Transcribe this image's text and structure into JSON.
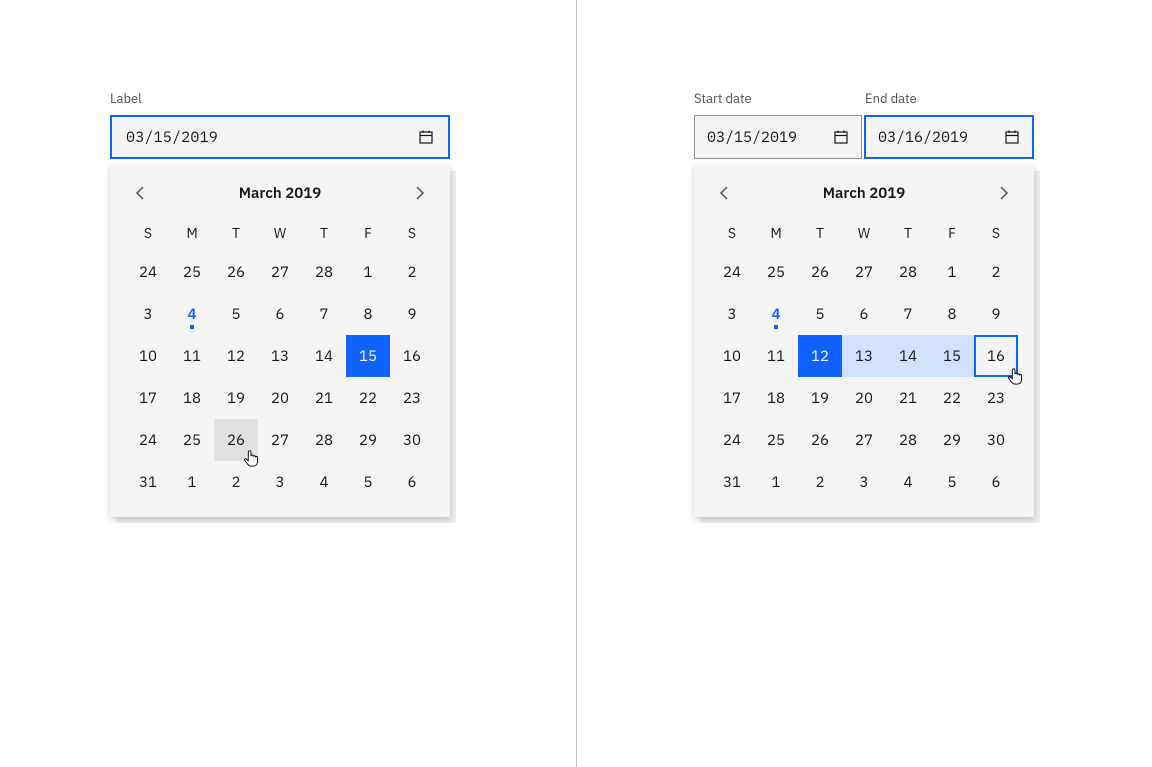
{
  "single": {
    "label": "Label",
    "value": "03/15/2019"
  },
  "range": {
    "start_label": "Start date",
    "end_label": "End date",
    "start_value": "03/15/2019",
    "end_value": "03/16/2019"
  },
  "calendar": {
    "month_year": "March  2019",
    "dow": [
      "S",
      "M",
      "T",
      "W",
      "T",
      "F",
      "S"
    ],
    "cells": [
      "24",
      "25",
      "26",
      "27",
      "28",
      "1",
      "2",
      "3",
      "4",
      "5",
      "6",
      "7",
      "8",
      "9",
      "10",
      "11",
      "12",
      "13",
      "14",
      "15",
      "16",
      "17",
      "18",
      "19",
      "20",
      "21",
      "22",
      "23",
      "24",
      "25",
      "26",
      "27",
      "28",
      "29",
      "30",
      "31",
      "1",
      "2",
      "3",
      "4",
      "5",
      "6"
    ]
  },
  "left_state": {
    "today_index": 8,
    "selected_index": 19,
    "hover_index": 30
  },
  "right_state": {
    "today_index": 8,
    "range_start_index": 16,
    "range_end_index": 20,
    "in_range_indices": [
      17,
      18,
      19
    ]
  },
  "colors": {
    "primary": "#0f62fe",
    "range_fill": "#d0e2ff",
    "hover_fill": "#e0e0e0",
    "surface": "#f4f4f4"
  }
}
